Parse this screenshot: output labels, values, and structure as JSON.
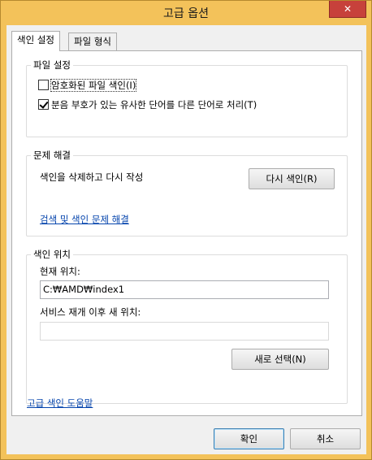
{
  "window": {
    "title": "고급 옵션",
    "close_glyph": "✕"
  },
  "tabs": [
    {
      "label": "색인 설정"
    },
    {
      "label": "파일 형식"
    }
  ],
  "file_settings": {
    "title": "파일 설정",
    "encrypted_label": "암호화된 파일 색인(I)",
    "encrypted_checked": false,
    "diacritics_label": "분음 부호가 있는 유사한 단어를 다른 단어로 처리(T)",
    "diacritics_checked": true
  },
  "troubleshoot": {
    "title": "문제 해결",
    "rebuild_text": "색인을 삭제하고 다시 작성",
    "rebuild_button": "다시 색인(R)",
    "link": "검색 및 색인 문제 해결"
  },
  "index_location": {
    "title": "색인 위치",
    "current_label": "현재 위치:",
    "current_value": "C:₩AMD₩index1",
    "new_label": "서비스 재개 이후 새 위치:",
    "new_value": "",
    "select_button": "새로 선택(N)"
  },
  "help_link": "고급 색인 도움말",
  "footer": {
    "ok": "확인",
    "cancel": "취소"
  }
}
